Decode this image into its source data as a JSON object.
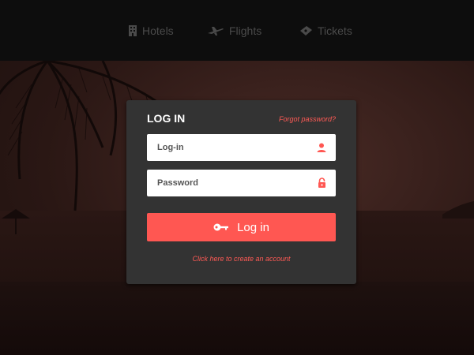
{
  "nav": {
    "items": [
      {
        "label": "Hotels",
        "icon": "hotel-icon"
      },
      {
        "label": "Flights",
        "icon": "airplane-icon"
      },
      {
        "label": "Tickets",
        "icon": "ticket-icon"
      }
    ]
  },
  "login": {
    "title": "LOG IN",
    "forgot_label": "Forgot password?",
    "username_placeholder": "Log-in",
    "password_placeholder": "Password",
    "submit_label": "Log in",
    "create_account_label": "Click here to create an account"
  },
  "colors": {
    "accent": "#ff5752",
    "card": "#333333",
    "nav_text": "#4a4a4a"
  }
}
